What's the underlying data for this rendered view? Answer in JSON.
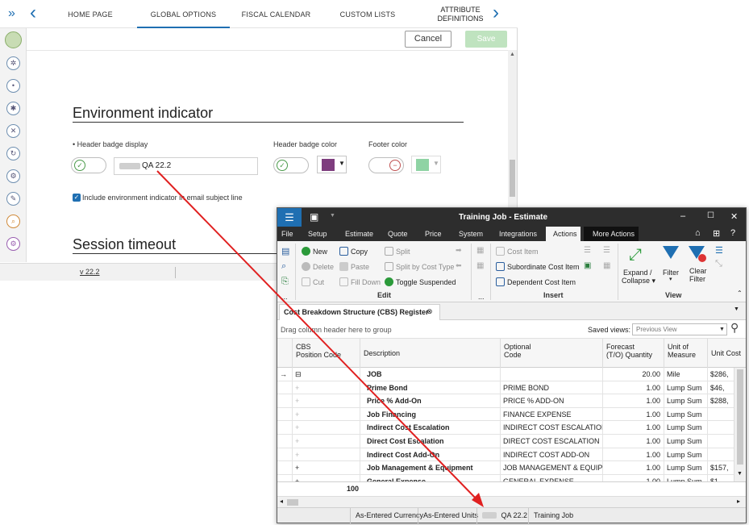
{
  "back": {
    "nav": {
      "tabs": [
        "HOME PAGE",
        "GLOBAL OPTIONS",
        "FISCAL CALENDAR",
        "CUSTOM LISTS"
      ],
      "tab_attr_line1": "ATTRIBUTE",
      "tab_attr_line2": "DEFINITIONS",
      "active_tab": "GLOBAL OPTIONS",
      "expand_icon": "»",
      "prev_icon": "‹",
      "next_icon": "›"
    },
    "toolbar": {
      "cancel": "Cancel",
      "save": "Save"
    },
    "env": {
      "title": "Environment indicator",
      "badge_display_label": "Header badge display",
      "badge_value": "QA 22.2",
      "badge_color_label": "Header badge color",
      "footer_color_label": "Footer color",
      "email_checkbox_label": "Include environment indicator in email subject line",
      "badge_color": "#7e3d7e",
      "footer_color": "#8fd3a4"
    },
    "session": {
      "title": "Session timeout"
    },
    "status": {
      "version": "v 22.2"
    }
  },
  "front": {
    "title": "Training Job - Estimate",
    "menu": [
      "File",
      "Setup",
      "Estimate",
      "Quote",
      "Price",
      "System",
      "Integrations",
      "Actions"
    ],
    "menu_active": "Actions",
    "menu_more": "More Actions",
    "ribbon": {
      "new": "New",
      "copy": "Copy",
      "split": "Split",
      "delete": "Delete",
      "paste": "Paste",
      "split_cost": "Split by Cost Type",
      "cut": "Cut",
      "fill_down": "Fill Down",
      "toggle_suspended": "Toggle Suspended",
      "edit_group": "Edit",
      "cost_item": "Cost Item",
      "subordinate": "Subordinate Cost Item",
      "dependent": "Dependent Cost Item",
      "insert_group": "Insert",
      "expand": "Expand /",
      "collapse": "Collapse",
      "filter": "Filter",
      "clear": "Clear",
      "clear2": "Filter",
      "view_group": "View",
      "more_dots": "..."
    },
    "doc_tab": "Cost Breakdown Structure (CBS) Register",
    "group_hint": "Drag column header here to group",
    "saved_views_label": "Saved views:",
    "saved_views_value": "Previous View",
    "columns": {
      "cbs1": "CBS",
      "cbs2": "Position Code",
      "desc": "Description",
      "opt1": "Optional",
      "opt2": "Code",
      "fq1": "Forecast",
      "fq2": "(T/O) Quantity",
      "uom1": "Unit of",
      "uom2": "Measure",
      "unit_cost": "Unit Cost"
    },
    "rows": [
      {
        "desc": "JOB",
        "code": "",
        "qty": "20.00",
        "uom": "Mile",
        "cost": "$286,"
      },
      {
        "desc": "Prime Bond",
        "code": "PRIME BOND",
        "qty": "1.00",
        "uom": "Lump Sum",
        "cost": "$46,"
      },
      {
        "desc": "Price % Add-On",
        "code": "PRICE % ADD-ON",
        "qty": "1.00",
        "uom": "Lump Sum",
        "cost": "$288,"
      },
      {
        "desc": "Job Financing",
        "code": "FINANCE EXPENSE",
        "qty": "1.00",
        "uom": "Lump Sum",
        "cost": ""
      },
      {
        "desc": "Indirect Cost Escalation",
        "code": "INDIRECT COST ESCALATION",
        "qty": "1.00",
        "uom": "Lump Sum",
        "cost": ""
      },
      {
        "desc": "Direct Cost Escalation",
        "code": "DIRECT COST ESCALATION",
        "qty": "1.00",
        "uom": "Lump Sum",
        "cost": ""
      },
      {
        "desc": "Indirect Cost Add-On",
        "code": "INDIRECT COST ADD-ON",
        "qty": "1.00",
        "uom": "Lump Sum",
        "cost": ""
      },
      {
        "desc": "Job Management & Equipment",
        "code": "JOB MANAGEMENT & EQUIPMENT",
        "qty": "1.00",
        "uom": "Lump Sum",
        "cost": "$157,"
      },
      {
        "desc": "General Expense",
        "code": "GENERAL EXPENSE",
        "qty": "1.00",
        "uom": "Lump Sum",
        "cost": "$1,"
      }
    ],
    "footer_count": "100",
    "status": {
      "currency": "As-Entered Currency",
      "units": "As-Entered Units",
      "env": "QA 22.2",
      "job": "Training Job"
    }
  }
}
